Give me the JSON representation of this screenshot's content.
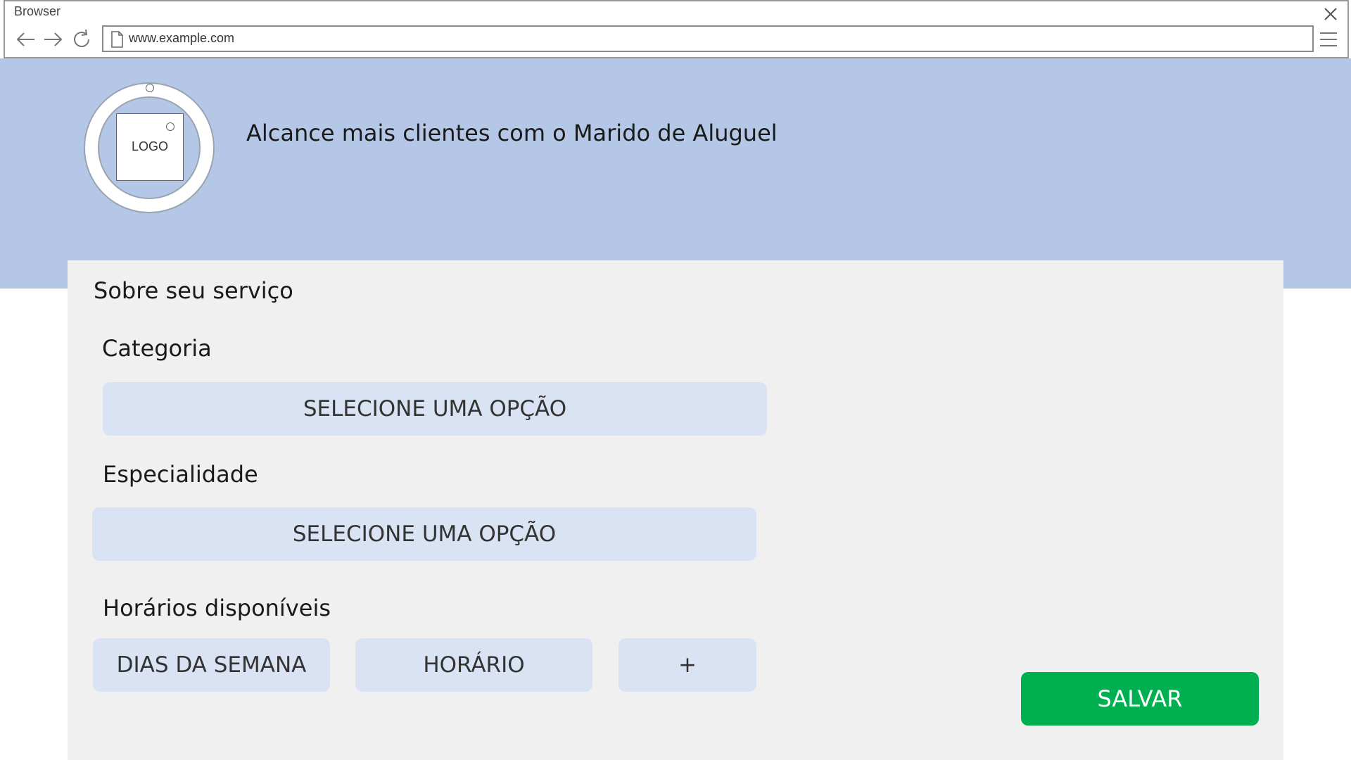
{
  "browser": {
    "title": "Browser",
    "url": "www.example.com",
    "icons": {
      "close": "close-icon",
      "back": "arrow-left-icon",
      "forward": "arrow-right-icon",
      "reload": "reload-icon",
      "page": "page-icon",
      "menu": "hamburger-menu-icon"
    }
  },
  "header": {
    "logo_text": "LOGO",
    "title": "Alcance mais clientes com o Marido de Aluguel",
    "background_color": "#b4c7e7"
  },
  "form": {
    "section_title": "Sobre seu serviço",
    "categoria": {
      "label": "Categoria",
      "select_value": "SELECIONE UMA OPÇÃO"
    },
    "especialidade": {
      "label": "Especialidade",
      "select_value": "SELECIONE UMA OPÇÃO"
    },
    "horarios": {
      "label": "Horários disponíveis",
      "dias_label": "DIAS DA SEMANA",
      "horario_label": "HORÁRIO",
      "add_label": "+"
    },
    "save_label": "SALVAR"
  },
  "colors": {
    "accent_save": "#00b050",
    "field_bg": "#dae3f3",
    "card_bg": "#f0f0f0"
  }
}
